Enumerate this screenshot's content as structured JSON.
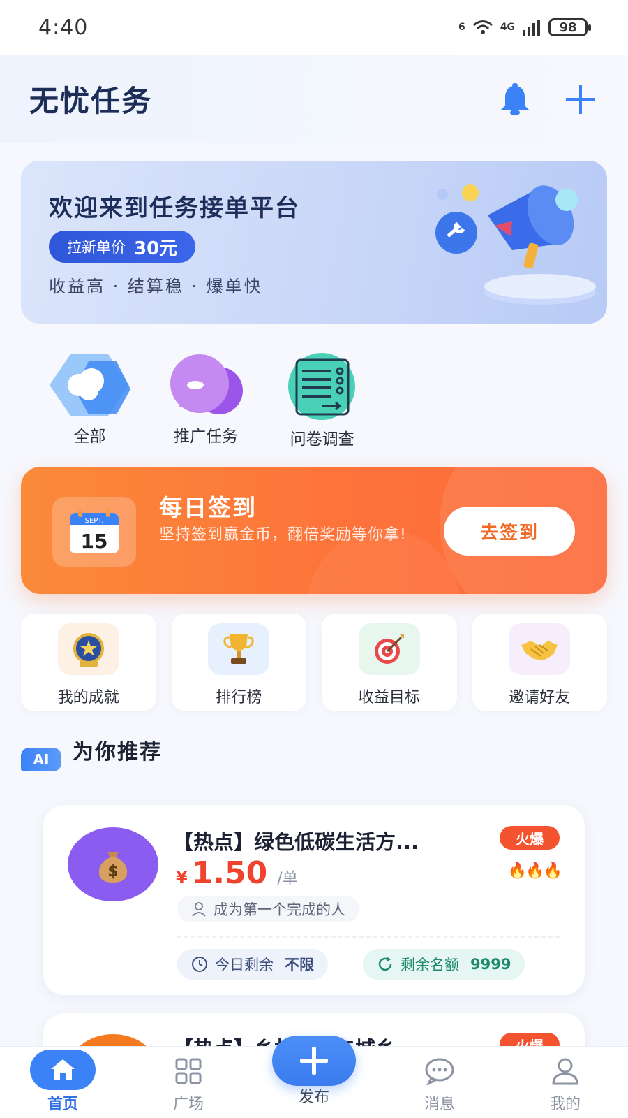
{
  "status": {
    "time": "4:40",
    "net1": "6",
    "net2": "4G",
    "battery": "98"
  },
  "header": {
    "title": "无忧任务"
  },
  "banner": {
    "title": "欢迎来到任务接单平台",
    "badge_label": "拉新单价",
    "badge_price": "30元",
    "subtitle": "收益高 · 结算稳 · 爆单快"
  },
  "categories": [
    {
      "label": "全部",
      "icon": "cloud-icon"
    },
    {
      "label": "推广任务",
      "icon": "chat-bubble-icon"
    },
    {
      "label": "问卷调查",
      "icon": "survey-icon"
    }
  ],
  "signin": {
    "title": "每日签到",
    "desc": "坚持签到赢金币，翻倍奖励等你拿!",
    "button": "去签到",
    "calendar_month": "SEPT.",
    "calendar_day": "15"
  },
  "quick_actions": [
    {
      "label": "我的成就",
      "icon": "badge-icon"
    },
    {
      "label": "排行榜",
      "icon": "trophy-icon"
    },
    {
      "label": "收益目标",
      "icon": "target-icon"
    },
    {
      "label": "邀请好友",
      "icon": "handshake-icon"
    }
  ],
  "recommend": {
    "ai": "AI",
    "title": "为你推荐"
  },
  "tasks": [
    {
      "title": "【热点】绿色低碳生活方...",
      "hot": "火爆",
      "flames": "🔥🔥🔥",
      "currency": "¥",
      "price": "1.50",
      "unit": "/单",
      "first": "成为第一个完成的人",
      "today_label": "今日剩余",
      "today_value": "不限",
      "quota_label": "剩余名额",
      "quota_value": "9999"
    },
    {
      "title": "【热点】乡村振兴与城乡",
      "hot": "火爆"
    }
  ],
  "tabs": [
    {
      "label": "首页"
    },
    {
      "label": "广场"
    },
    {
      "label": "发布"
    },
    {
      "label": "消息"
    },
    {
      "label": "我的"
    }
  ],
  "colors": {
    "primary": "#3b82f6",
    "orange": "#fd733a",
    "price": "#f0432d"
  }
}
